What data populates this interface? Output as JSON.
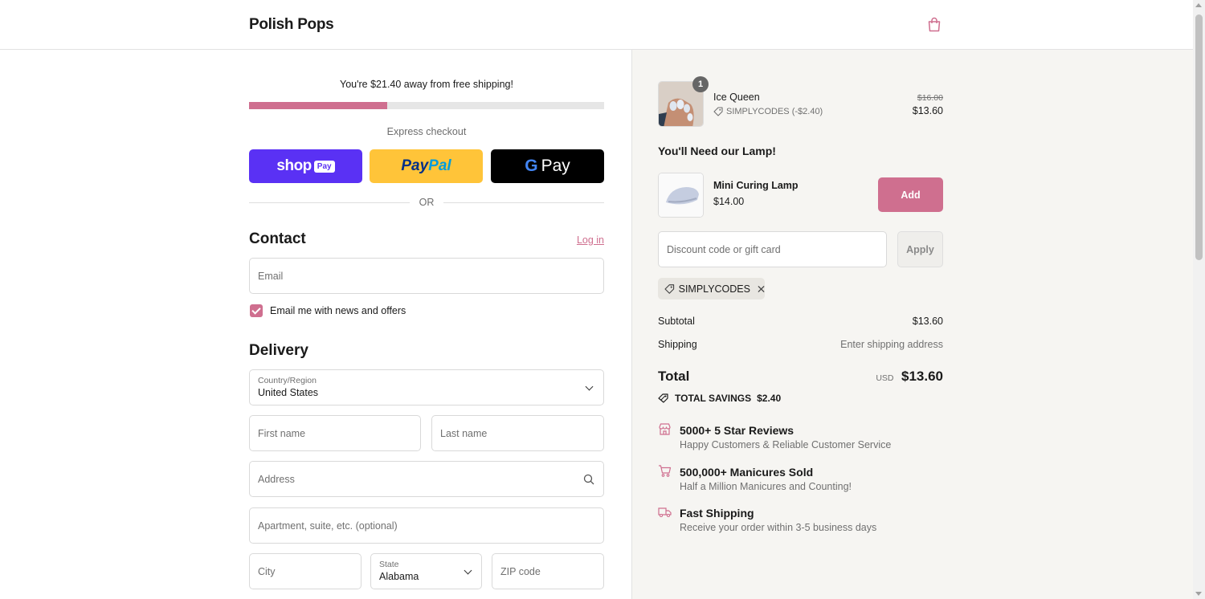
{
  "header": {
    "brand": "Polish Pops",
    "cart_icon": "shopping-bag-icon"
  },
  "shipping_banner": {
    "message": "You're $21.40 away from free shipping!",
    "progress_percent": 39
  },
  "express_checkout": {
    "label": "Express checkout",
    "shop_pay_word": "shop",
    "shop_pay_badge": "Pay",
    "paypal_part1": "Pay",
    "paypal_part2": "Pal",
    "gpay_g": "G",
    "gpay_word": "Pay",
    "or_label": "OR"
  },
  "contact": {
    "heading": "Contact",
    "login_label": "Log in",
    "email_placeholder": "Email",
    "newsletter_label": "Email me with news and offers",
    "newsletter_checked": true
  },
  "delivery": {
    "heading": "Delivery",
    "country_label": "Country/Region",
    "country_value": "United States",
    "first_name_placeholder": "First name",
    "last_name_placeholder": "Last name",
    "address_placeholder": "Address",
    "apartment_placeholder": "Apartment, suite, etc. (optional)",
    "city_placeholder": "City",
    "state_label": "State",
    "state_value": "Alabama",
    "zip_placeholder": "ZIP code"
  },
  "order": {
    "item": {
      "name": "Ice Queen",
      "quantity": "1",
      "discount": "SIMPLYCODES (-$2.40)",
      "original_price": "$16.00",
      "price": "$13.60"
    },
    "upsell": {
      "heading": "You'll Need our Lamp!",
      "name": "Mini Curing Lamp",
      "price": "$14.00",
      "add_label": "Add"
    },
    "discount": {
      "placeholder": "Discount code or gift card",
      "apply_label": "Apply",
      "applied_code": "SIMPLYCODES"
    },
    "summary": {
      "subtotal_label": "Subtotal",
      "subtotal_value": "$13.60",
      "shipping_label": "Shipping",
      "shipping_value": "Enter shipping address",
      "total_label": "Total",
      "currency": "USD",
      "total_value": "$13.60",
      "savings_label": "TOTAL SAVINGS",
      "savings_value": "$2.40"
    },
    "features": [
      {
        "title": "5000+ 5 Star Reviews",
        "subtitle": "Happy Customers & Reliable Customer Service",
        "icon": "store-icon"
      },
      {
        "title": "500,000+ Manicures Sold",
        "subtitle": "Half a Million Manicures and Counting!",
        "icon": "cart-icon"
      },
      {
        "title": "Fast Shipping",
        "subtitle": "Receive your order within 3-5 business days",
        "icon": "truck-icon"
      }
    ]
  },
  "colors": {
    "accent": "#cf6f8f",
    "shop_pay": "#5a31f4",
    "paypal": "#ffc439",
    "summary_bg": "#f6f5f2"
  }
}
